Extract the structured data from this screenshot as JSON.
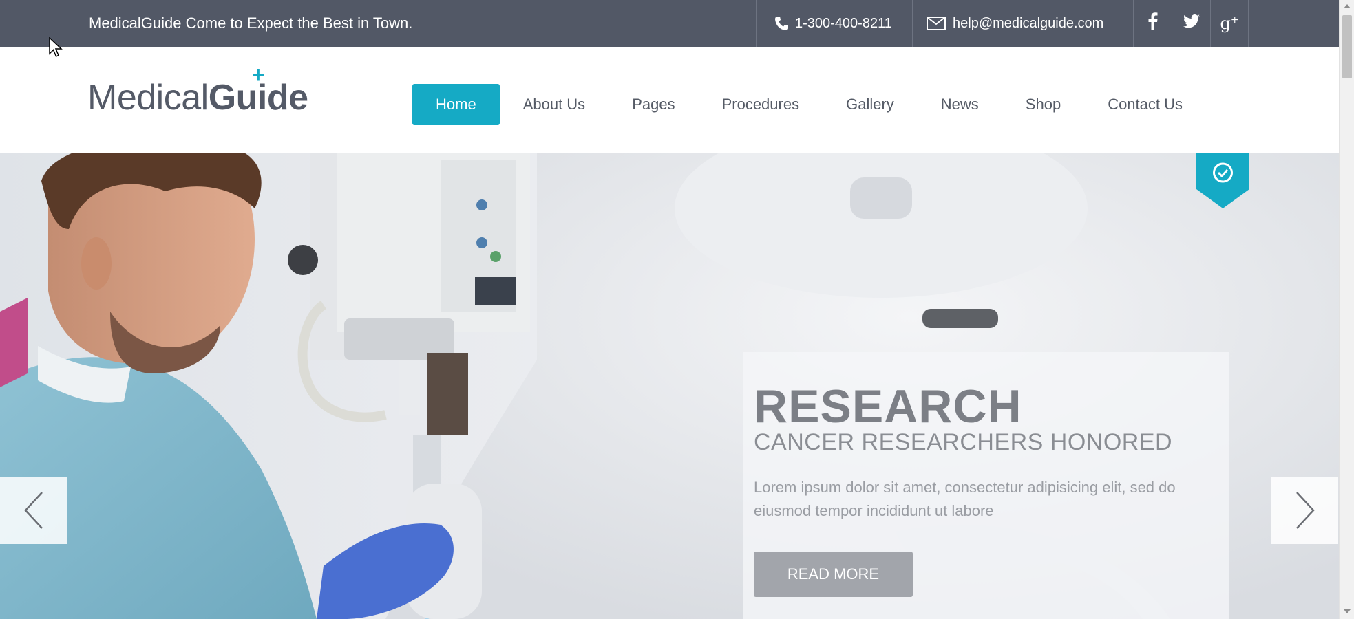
{
  "topbar": {
    "tagline": "MedicalGuide Come to Expect the Best in Town.",
    "phone": "1-300-400-8211",
    "email": "help@medicalguide.com",
    "social": [
      {
        "icon": "facebook-icon",
        "glyph": "f"
      },
      {
        "icon": "twitter-icon",
        "glyph": "twitter"
      },
      {
        "icon": "google-plus-icon",
        "glyph": "g+"
      }
    ]
  },
  "logo": {
    "part1": "Medical",
    "part2": "Guide",
    "plus": "+"
  },
  "nav": {
    "items": [
      {
        "label": "Home",
        "active": true
      },
      {
        "label": "About Us"
      },
      {
        "label": "Pages"
      },
      {
        "label": "Procedures"
      },
      {
        "label": "Gallery"
      },
      {
        "label": "News"
      },
      {
        "label": "Shop"
      },
      {
        "label": "Contact Us"
      }
    ]
  },
  "hero": {
    "title": "RESEARCH",
    "subtitle": "CANCER RESEARCHERS HONORED",
    "text": "Lorem ipsum dolor sit amet, consectetur adipisicing elit, sed do eiusmod tempor incididunt ut labore",
    "button": "READ MORE",
    "prev_icon": "chevron-left-icon",
    "next_icon": "chevron-right-icon",
    "badge_icon": "clock-icon"
  },
  "colors": {
    "accent": "#15aac5",
    "topbar": "#525866",
    "text": "#555b66"
  }
}
